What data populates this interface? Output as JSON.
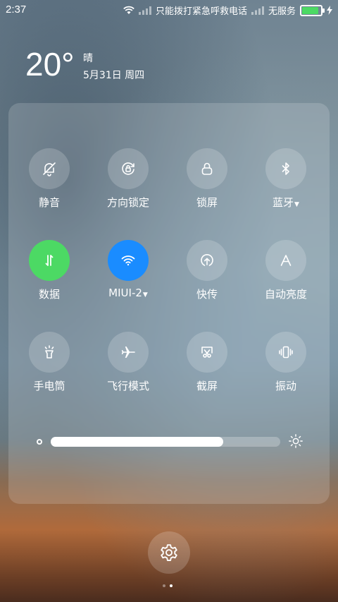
{
  "status": {
    "time": "2:37",
    "carrier1": "只能拨打紧急呼救电话",
    "carrier2": "无服务",
    "battery_level": 0.95,
    "battery_color": "#4cd964"
  },
  "weather": {
    "temperature": "20°",
    "condition": "晴",
    "date": "5月31日 周四"
  },
  "toggles": [
    {
      "label": "静音",
      "icon": "bell-off-icon",
      "active": false,
      "caret": false
    },
    {
      "label": "方向锁定",
      "icon": "rotation-lock-icon",
      "active": false,
      "caret": false
    },
    {
      "label": "锁屏",
      "icon": "lock-icon",
      "active": false,
      "caret": false
    },
    {
      "label": "蓝牙",
      "icon": "bluetooth-icon",
      "active": false,
      "caret": true
    },
    {
      "label": "数据",
      "icon": "mobile-data-icon",
      "active": true,
      "activeColor": "#4cd964",
      "caret": false
    },
    {
      "label": "MIUI-2",
      "icon": "wifi-icon",
      "active": true,
      "activeColor": "#1a8cff",
      "caret": true
    },
    {
      "label": "快传",
      "icon": "quick-transfer-icon",
      "active": false,
      "caret": false
    },
    {
      "label": "自动亮度",
      "icon": "auto-brightness-icon",
      "active": false,
      "caret": false
    },
    {
      "label": "手电筒",
      "icon": "flashlight-icon",
      "active": false,
      "caret": false
    },
    {
      "label": "飞行模式",
      "icon": "airplane-icon",
      "active": false,
      "caret": false
    },
    {
      "label": "截屏",
      "icon": "screenshot-icon",
      "active": false,
      "caret": false
    },
    {
      "label": "振动",
      "icon": "vibrate-icon",
      "active": false,
      "caret": false
    }
  ],
  "brightness": {
    "level": 0.75
  },
  "settings": {
    "icon": "gear-icon"
  },
  "pager": {
    "pages": 2,
    "current": 1
  }
}
